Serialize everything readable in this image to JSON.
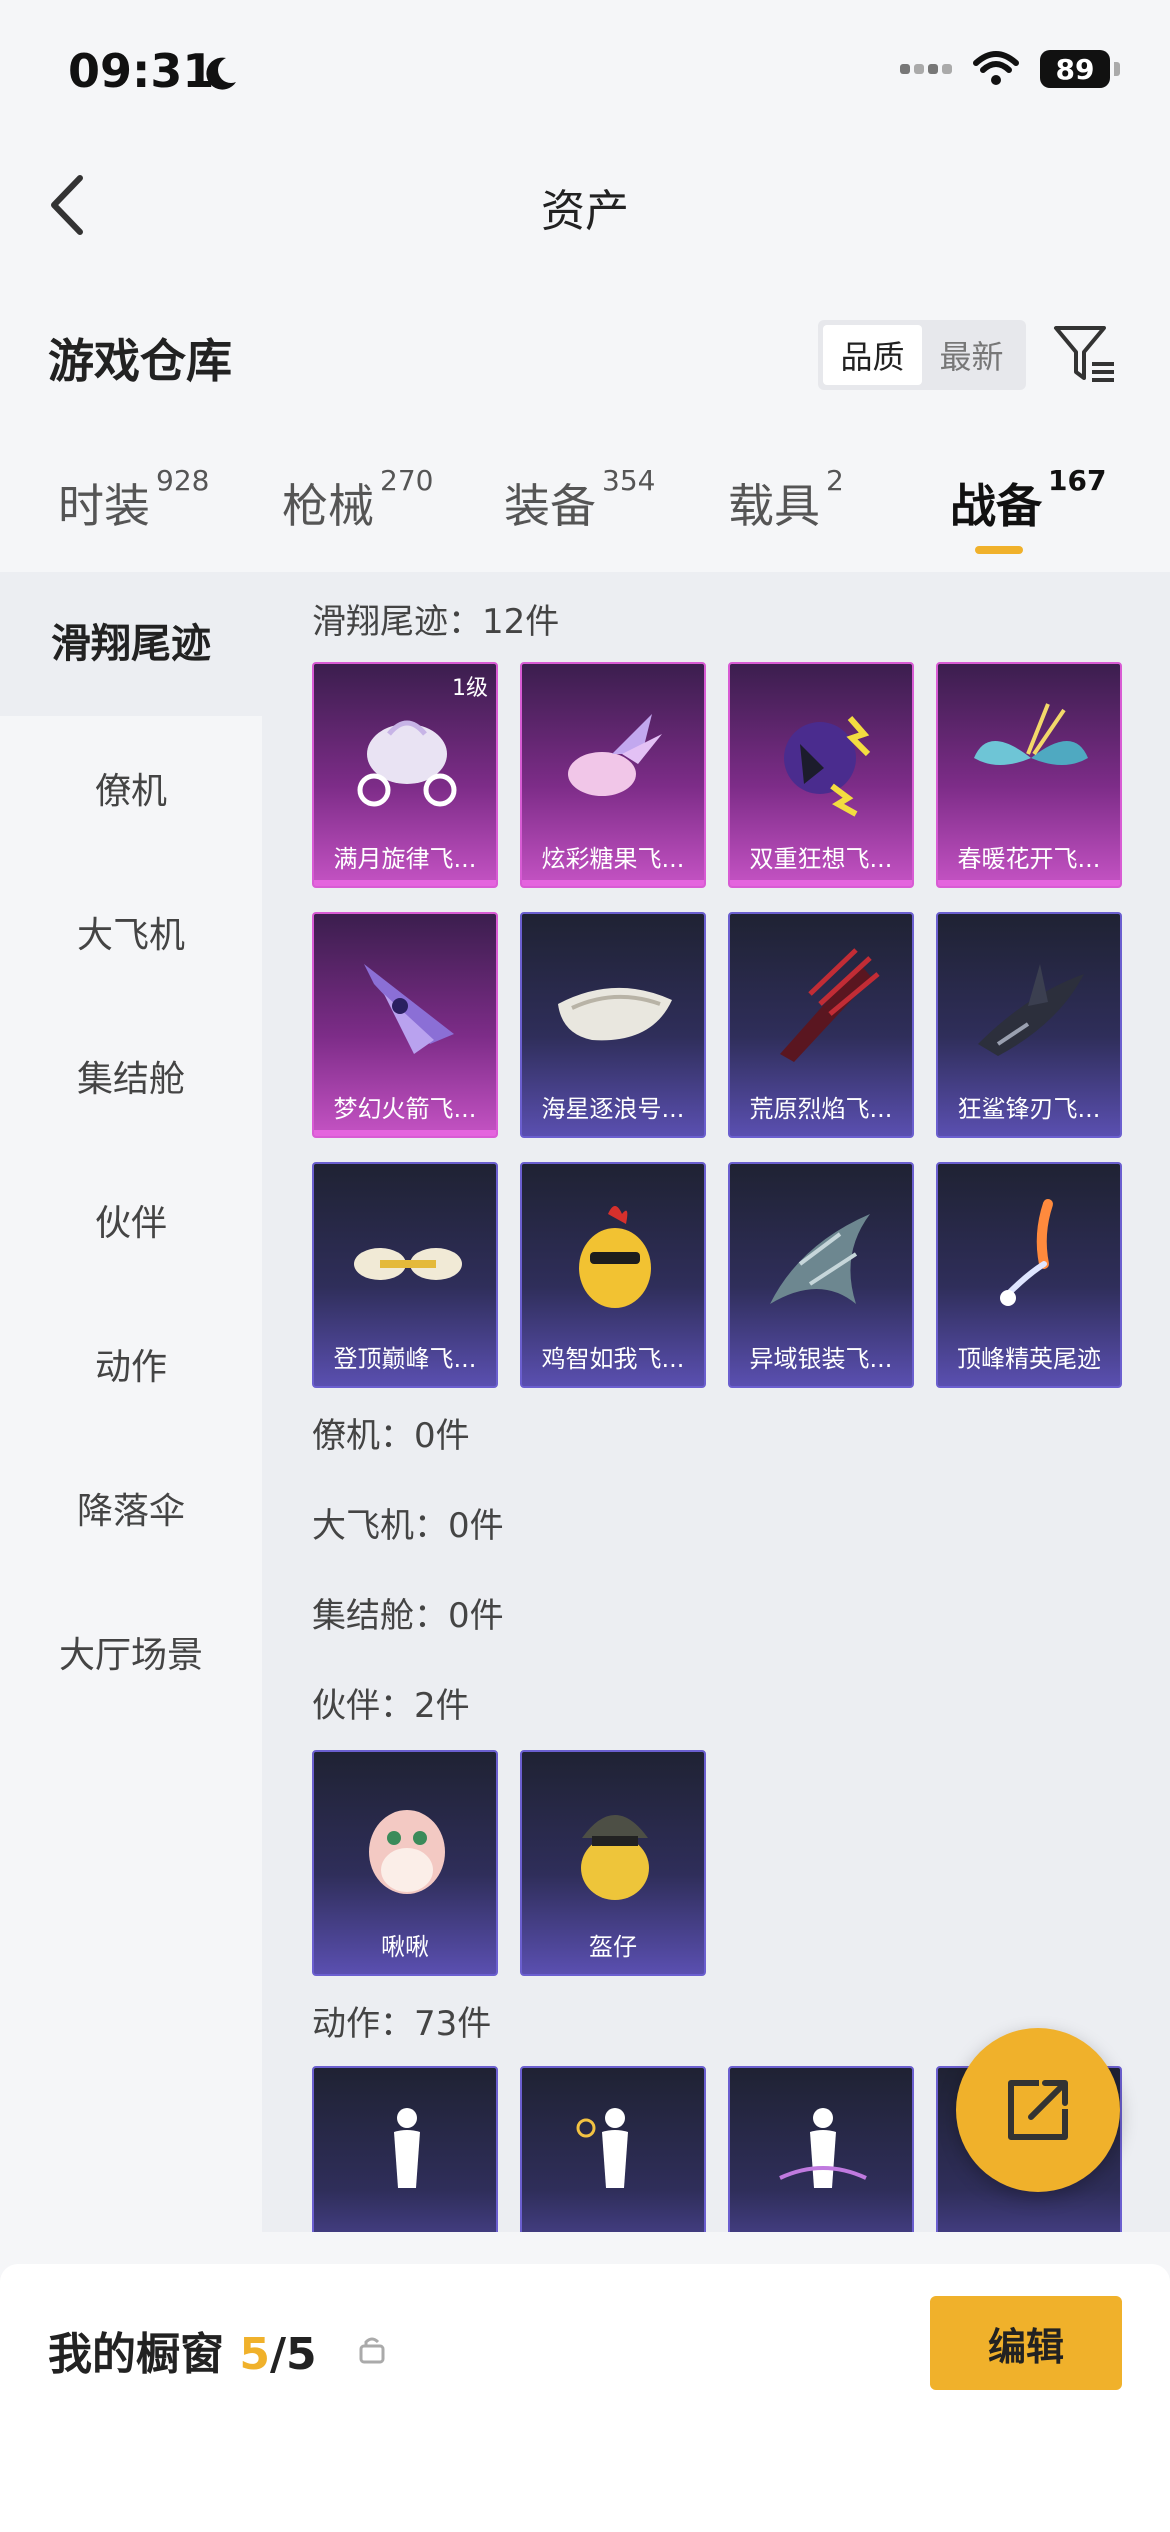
{
  "status_bar": {
    "time": "09:31",
    "battery": "89"
  },
  "nav": {
    "title": "资产"
  },
  "warehouse": {
    "title": "游戏仓库",
    "sort_options": [
      "品质",
      "最新"
    ],
    "active_sort": "品质"
  },
  "tabs": [
    {
      "label": "时装",
      "count": "928"
    },
    {
      "label": "枪械",
      "count": "270"
    },
    {
      "label": "装备",
      "count": "354"
    },
    {
      "label": "载具",
      "count": "2"
    },
    {
      "label": "战备",
      "count": "167"
    }
  ],
  "side_items": [
    "滑翔尾迹",
    "僚机",
    "大飞机",
    "集结舱",
    "伙伴",
    "动作",
    "降落伞",
    "大厅场景"
  ],
  "sections": {
    "glide": {
      "label": "滑翔尾迹：12件",
      "items": [
        {
          "name": "满月旋律飞...",
          "level": "1级",
          "tone": "purple"
        },
        {
          "name": "炫彩糖果飞...",
          "tone": "purple"
        },
        {
          "name": "双重狂想飞...",
          "tone": "purple"
        },
        {
          "name": "春暖花开飞...",
          "tone": "purple"
        },
        {
          "name": "梦幻火箭飞...",
          "tone": "purple"
        },
        {
          "name": "海星逐浪号...",
          "tone": "blue"
        },
        {
          "name": "荒原烈焰飞...",
          "tone": "blue"
        },
        {
          "name": "狂鲨锋刃飞...",
          "tone": "blue"
        },
        {
          "name": "登顶巅峰飞...",
          "tone": "blue"
        },
        {
          "name": "鸡智如我飞...",
          "tone": "blue"
        },
        {
          "name": "异域银装飞...",
          "tone": "blue"
        },
        {
          "name": "顶峰精英尾迹",
          "tone": "blue"
        }
      ]
    },
    "wingman": {
      "label": "僚机：0件"
    },
    "plane": {
      "label": "大飞机：0件"
    },
    "capsule": {
      "label": "集结舱：0件"
    },
    "partner": {
      "label": "伙伴：2件",
      "items": [
        {
          "name": "啾啾",
          "tone": "blue"
        },
        {
          "name": "盔仔",
          "tone": "blue"
        }
      ]
    },
    "action": {
      "label": "动作：73件"
    }
  },
  "bottom": {
    "showcase_label": "我的橱窗",
    "showcase_current": "5",
    "showcase_total": "/5",
    "edit_label": "编辑"
  }
}
